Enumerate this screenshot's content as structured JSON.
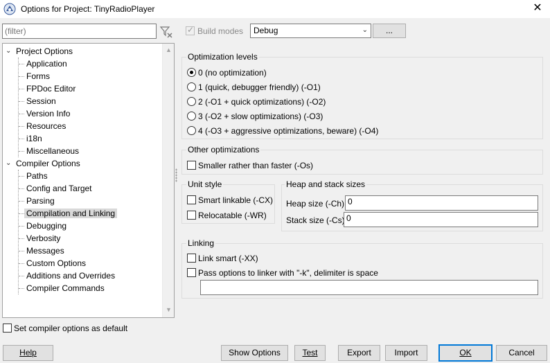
{
  "window": {
    "title": "Options for Project: TinyRadioPlayer",
    "close_glyph": "✕"
  },
  "filter": {
    "placeholder": "(filter)"
  },
  "tree": {
    "project_options": {
      "label": "Project Options",
      "children": [
        "Application",
        "Forms",
        "FPDoc Editor",
        "Session",
        "Version Info",
        "Resources",
        "i18n",
        "Miscellaneous"
      ]
    },
    "compiler_options": {
      "label": "Compiler Options",
      "children": [
        "Paths",
        "Config and Target",
        "Parsing",
        "Compilation and Linking",
        "Debugging",
        "Verbosity",
        "Messages",
        "Custom Options",
        "Additions and Overrides",
        "Compiler Commands"
      ],
      "selected": "Compilation and Linking"
    }
  },
  "build_modes": {
    "label": "Build modes",
    "checked": true,
    "value": "Debug",
    "more_button": "..."
  },
  "optimization_levels": {
    "title": "Optimization levels",
    "options": [
      "0 (no optimization)",
      "1 (quick, debugger friendly) (-O1)",
      "2 (-O1 + quick optimizations) (-O2)",
      "3 (-O2 + slow optimizations) (-O3)",
      "4 (-O3 + aggressive optimizations, beware) (-O4)"
    ],
    "selected_index": 0
  },
  "other_optimizations": {
    "title": "Other optimizations",
    "smaller": "Smaller rather than faster (-Os)"
  },
  "unit_style": {
    "title": "Unit style",
    "smart_linkable": "Smart linkable (-CX)",
    "relocatable": "Relocatable (-WR)"
  },
  "heap_stack": {
    "title": "Heap and stack sizes",
    "heap_label": "Heap size (-Ch)",
    "heap_value": "0",
    "stack_label": "Stack size (-Cs)",
    "stack_value": "0"
  },
  "linking": {
    "title": "Linking",
    "link_smart": "Link smart (-XX)",
    "pass_options": "Pass options to linker with \"-k\", delimiter is space",
    "linker_options_value": ""
  },
  "set_default": "Set compiler options as default",
  "buttons": {
    "help": "Help",
    "show_options": "Show Options",
    "test": "Test",
    "export": "Export",
    "import": "Import",
    "ok": "OK",
    "cancel": "Cancel"
  },
  "colors": {
    "accent": "#0078d7",
    "selection": "#d9d9d9"
  }
}
